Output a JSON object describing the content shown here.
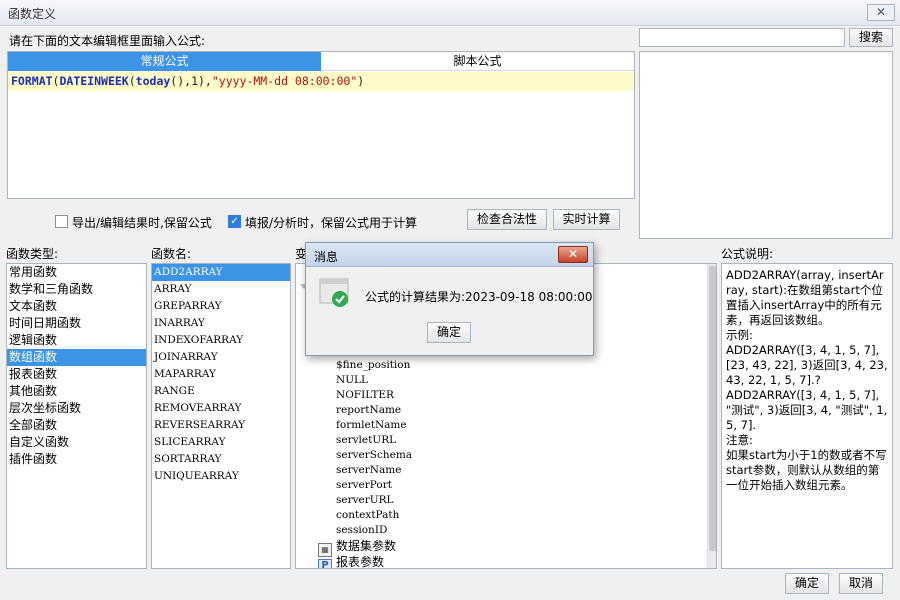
{
  "window": {
    "title": "函数定义",
    "close_glyph": "✕"
  },
  "editor": {
    "instruction": "请在下面的文本编辑框里面输入公式:",
    "tabs": [
      "常规公式",
      "脚本公式"
    ],
    "formula": {
      "fn1": "FORMAT",
      "p1": "(",
      "fn2": "DATEINWEEK",
      "p2": "(",
      "fn3": "today",
      "p3": "(),1),",
      "str": "\"yyyy-MM-dd 08:00:00\"",
      "p4": ")"
    }
  },
  "search": {
    "value": "",
    "button": "搜索"
  },
  "options": {
    "export_keep": "导出/编辑结果时,保留公式",
    "fill_keep": "填报/分析时，保留公式用于计算",
    "check_button": "检查合法性",
    "calc_button": "实时计算"
  },
  "categories": {
    "header": "函数类型:",
    "items": [
      "常用函数",
      "数学和三角函数",
      "文本函数",
      "时间日期函数",
      "逻辑函数",
      "数组函数",
      "报表函数",
      "其他函数",
      "层次坐标函数",
      "全部函数",
      "自定义函数",
      "插件函数"
    ],
    "selected_index": 5
  },
  "functions": {
    "header": "函数名:",
    "items": [
      "ADD2ARRAY",
      "ARRAY",
      "GREPARRAY",
      "INARRAY",
      "INDEXOFARRAY",
      "JOINARRAY",
      "MAPARRAY",
      "RANGE",
      "REMOVEARRAY",
      "REVERSEARRAY",
      "SLICEARRAY",
      "SORTARRAY",
      "UNIQUEARRAY"
    ],
    "selected_index": 0
  },
  "variables": {
    "header": "变",
    "items": [
      "$fine_position",
      "NULL",
      "NOFILTER",
      "reportName",
      "formletName",
      "servletURL",
      "serverSchema",
      "serverName",
      "serverPort",
      "serverURL",
      "contextPath",
      "sessionID"
    ],
    "groups": [
      {
        "icon": "dataset-params-icon",
        "label": "数据集参数"
      },
      {
        "icon": "report-params-icon",
        "label": "报表参数",
        "badge": "P"
      }
    ]
  },
  "description": {
    "header": "公式说明:",
    "paragraphs": [
      "ADD2ARRAY(array, insertArray, start):在数组第start个位置插入insertArray中的所有元素，再返回该数组。",
      "示例:",
      "ADD2ARRAY([3, 4, 1, 5, 7], [23, 43, 22], 3)返回[3, 4, 23, 43, 22, 1, 5, 7].?",
      "ADD2ARRAY([3, 4, 1, 5, 7], \"测试\", 3)返回[3, 4, \"测试\", 1, 5, 7].",
      "注意:",
      "如果start为小于1的数或者不写start参数，则默认从数组的第一位开始插入数组元素。"
    ]
  },
  "footer": {
    "ok": "确定",
    "cancel": "取消"
  },
  "modal": {
    "title": "消息",
    "close_glyph": "✕",
    "message": "公式的计算结果为:2023-09-18 08:00:00",
    "ok": "确定"
  }
}
